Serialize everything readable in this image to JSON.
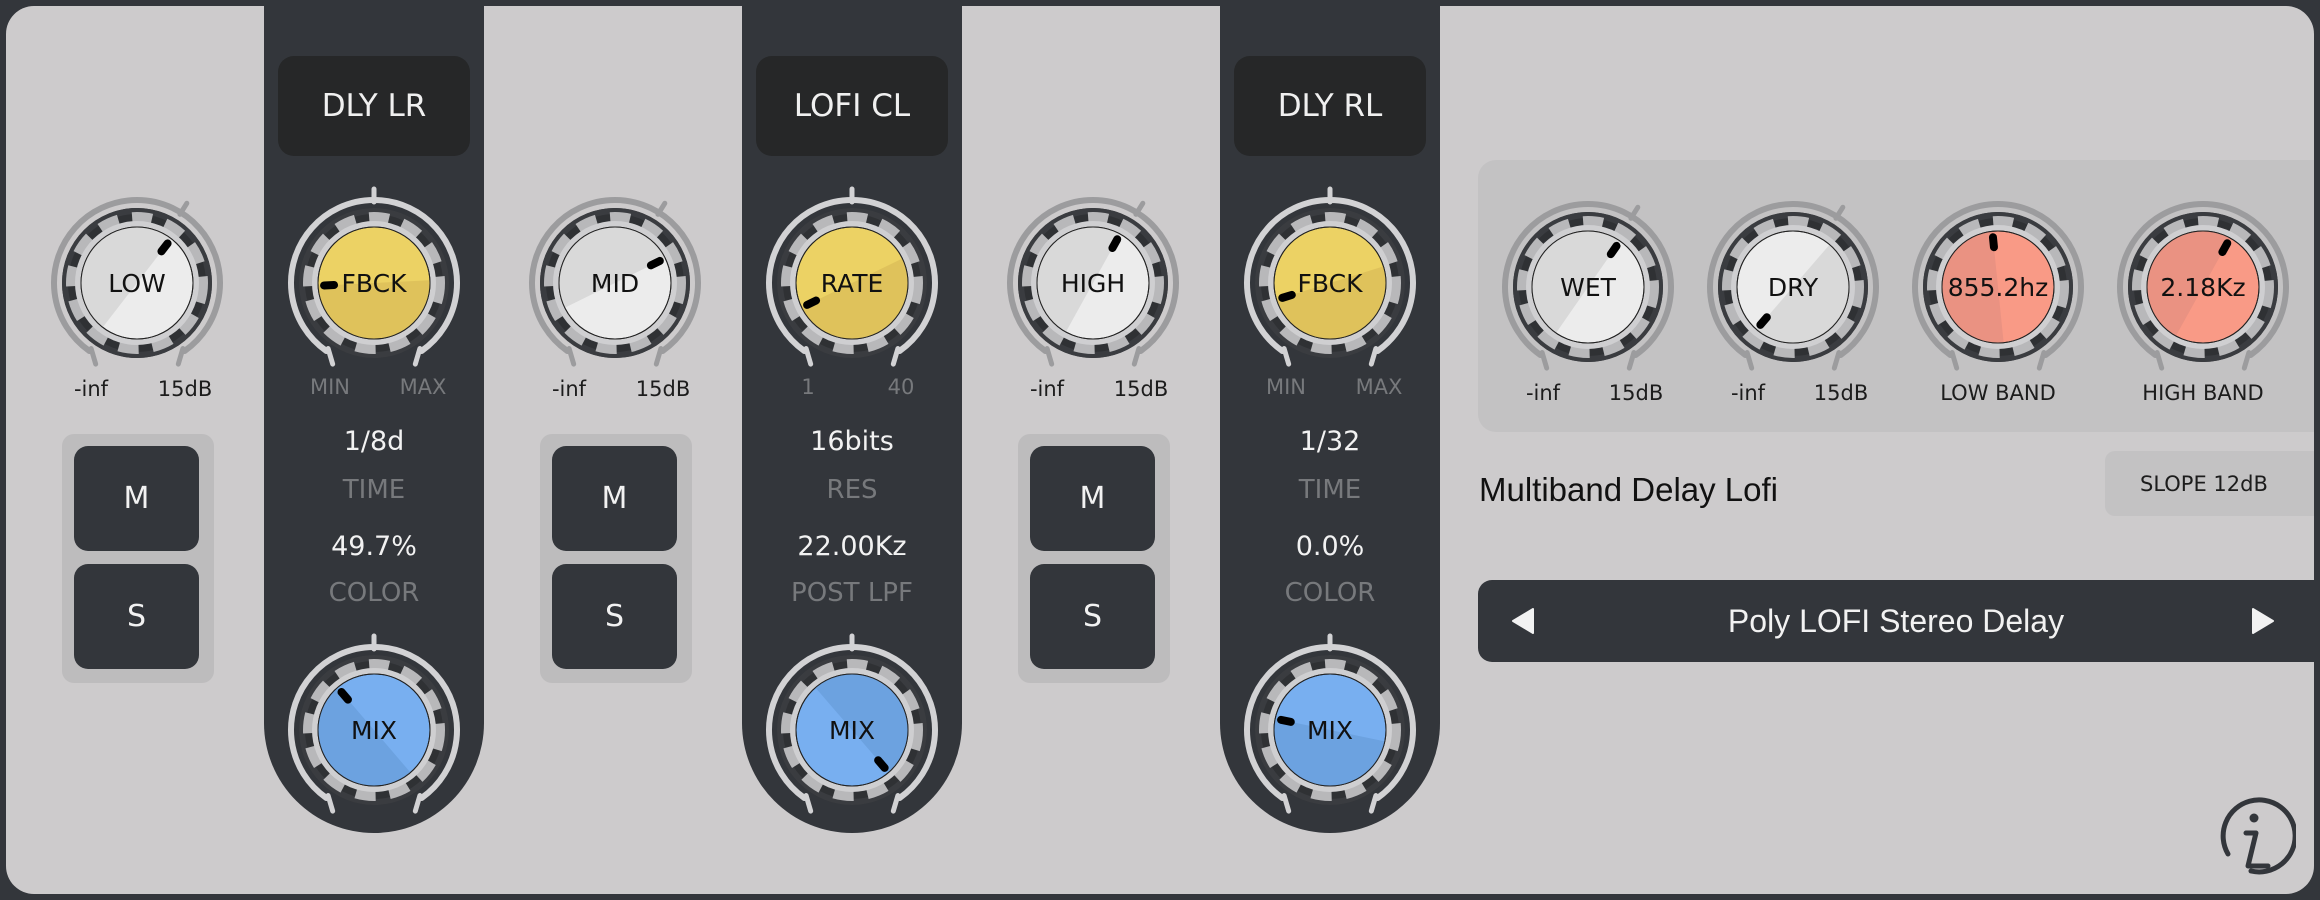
{
  "app": {
    "title": "Multiband Delay Lofi"
  },
  "colors": {
    "frame": "#33363b",
    "background": "#cdcbcc",
    "knob_white": "#ececec",
    "knob_yellow": "#ecd264",
    "knob_blue": "#78aff0",
    "knob_salmon": "#f99a86"
  },
  "bands": [
    {
      "id": "low",
      "gain_knob": {
        "label": "LOW",
        "value": 0.63,
        "scale_min": "-inf",
        "scale_max": "15dB"
      },
      "mute_label": "M",
      "solo_label": "S"
    },
    {
      "id": "mid",
      "gain_knob": {
        "label": "MID",
        "value": 0.72,
        "scale_min": "-inf",
        "scale_max": "15dB"
      },
      "mute_label": "M",
      "solo_label": "S"
    },
    {
      "id": "high",
      "gain_knob": {
        "label": "HIGH",
        "value": 0.6,
        "scale_min": "-inf",
        "scale_max": "15dB"
      },
      "mute_label": "M",
      "solo_label": "S"
    }
  ],
  "strips": [
    {
      "title": "DLY LR",
      "main_knob": {
        "label": "FBCK",
        "value": 0.18,
        "scale_min": "MIN",
        "scale_max": "MAX"
      },
      "param1": {
        "value": "1/8d",
        "caption": "TIME"
      },
      "param2": {
        "value": "49.7%",
        "caption": "COLOR"
      },
      "mix_knob": {
        "label": "MIX",
        "value": 0.36
      }
    },
    {
      "title": "LOFI CL",
      "main_knob": {
        "label": "RATE",
        "value": 0.1,
        "scale_min": "1",
        "scale_max": "40"
      },
      "param1": {
        "value": "16bits",
        "caption": "RES"
      },
      "param2": {
        "value": "22.00Kz",
        "caption": "POST LPF"
      },
      "mix_knob": {
        "label": "MIX",
        "value": 0.98
      }
    },
    {
      "title": "DLY RL",
      "main_knob": {
        "label": "FBCK",
        "value": 0.13,
        "scale_min": "MIN",
        "scale_max": "MAX"
      },
      "param1": {
        "value": "1/32",
        "caption": "TIME"
      },
      "param2": {
        "value": "0.0%",
        "caption": "COLOR"
      },
      "mix_knob": {
        "label": "MIX",
        "value": 0.23
      }
    }
  ],
  "output": {
    "wet": {
      "label": "WET",
      "value": 0.62,
      "scale_min": "-inf",
      "scale_max": "15dB"
    },
    "dry": {
      "label": "DRY",
      "value": 0.02,
      "scale_min": "-inf",
      "scale_max": "15dB"
    },
    "low_band": {
      "display": "855.2hz",
      "caption": "LOW BAND",
      "value": 0.48
    },
    "high_band": {
      "display": "2.18Kz",
      "caption": "HIGH BAND",
      "value": 0.6
    }
  },
  "plugin_title": "Multiband Delay Lofi",
  "slope_button": "SLOPE 12dB",
  "preset": {
    "name": "Poly LOFI Stereo Delay",
    "prev_icon": "triangle-left-icon",
    "next_icon": "triangle-right-icon"
  },
  "info_icon": "info-icon"
}
